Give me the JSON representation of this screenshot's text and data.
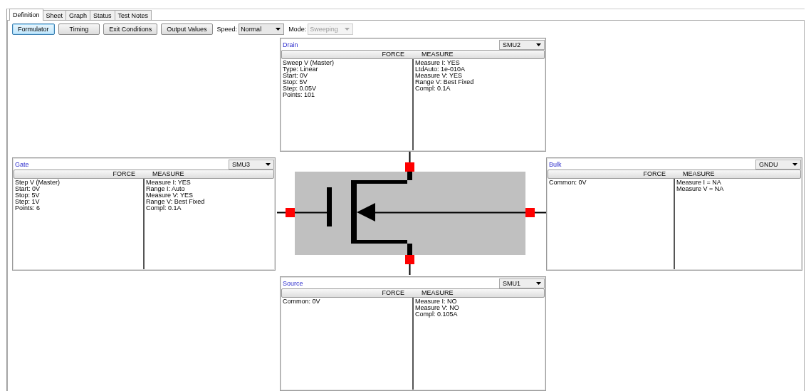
{
  "tabs": [
    {
      "label": "Definition",
      "selected": true
    },
    {
      "label": "Sheet",
      "selected": false
    },
    {
      "label": "Graph",
      "selected": false
    },
    {
      "label": "Status",
      "selected": false
    },
    {
      "label": "Test Notes",
      "selected": false
    }
  ],
  "toolbar": {
    "buttons": [
      {
        "label": "Formulator",
        "selected": true
      },
      {
        "label": "Timing",
        "selected": false
      },
      {
        "label": "Exit Conditions",
        "selected": false
      },
      {
        "label": "Output Values",
        "selected": false
      }
    ],
    "combos": [
      {
        "label": "Speed:",
        "value": "Normal",
        "disabled": false
      },
      {
        "label": "Mode:",
        "value": "Sweeping",
        "disabled": true
      }
    ]
  },
  "terminals": [
    {
      "kind": "top",
      "name": "Drain",
      "unit": "SMU2",
      "force_header": "FORCE",
      "measure_header": "MEASURE",
      "force": [
        "Sweep V (Master)",
        "Type: Linear",
        "Start: 0V",
        "Stop: 5V",
        "Step: 0.05V",
        "Points: 101"
      ],
      "measure": [
        "Measure I: YES",
        "LtdAuto: 1e-010A",
        "Measure V: YES",
        "Range V: Best Fixed",
        "Compl: 0.1A"
      ]
    },
    {
      "kind": "left",
      "name": "Gate",
      "unit": "SMU3",
      "force_header": "FORCE",
      "measure_header": "MEASURE",
      "force": [
        "Step V (Master)",
        "Start: 0V",
        "Stop: 5V",
        "Step: 1V",
        "Points: 6"
      ],
      "measure": [
        "Measure I: YES",
        "Range I: Auto",
        "Measure V: YES",
        "Range V: Best Fixed",
        "Compl: 0.1A"
      ]
    },
    {
      "kind": "right",
      "name": "Bulk",
      "unit": "GNDU",
      "force_header": "FORCE",
      "measure_header": "MEASURE",
      "force": [
        "Common: 0V"
      ],
      "measure": [
        "Measure I = NA",
        "Measure V = NA"
      ]
    },
    {
      "kind": "bottom",
      "name": "Source",
      "unit": "SMU1",
      "force_header": "FORCE",
      "measure_header": "MEASURE",
      "force": [
        "Common: 0V"
      ],
      "measure": [
        "Measure I: NO",
        "Measure V: NO",
        "Compl: 0.105A"
      ]
    }
  ]
}
